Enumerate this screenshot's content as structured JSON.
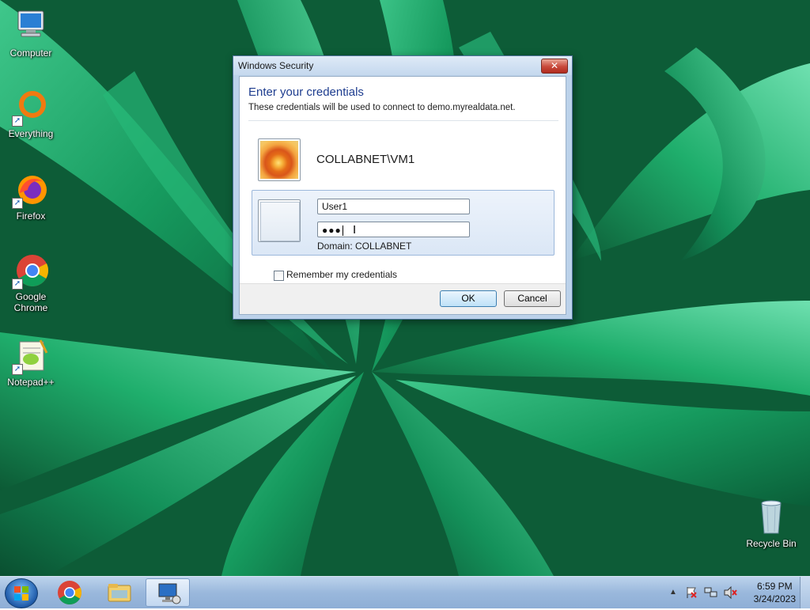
{
  "desktop": {
    "icons": [
      {
        "label": "Computer",
        "icon": "computer-icon"
      },
      {
        "label": "Everything",
        "icon": "everything-icon"
      },
      {
        "label": "Firefox",
        "icon": "firefox-icon"
      },
      {
        "label": "Google Chrome",
        "icon": "chrome-icon"
      },
      {
        "label": "Notepad++",
        "icon": "notepad-plus-plus-icon"
      },
      {
        "label": "Recycle Bin",
        "icon": "recycle-bin-icon"
      }
    ]
  },
  "dialog": {
    "window_title": "Windows Security",
    "close_glyph": "✕",
    "heading": "Enter your credentials",
    "subheading": "These credentials will be used to connect to demo.myrealdata.net.",
    "account_name": "COLLABNET\\VM1",
    "username_value": "User1",
    "password_mask": "●●●",
    "domain_label": "Domain: COLLABNET",
    "remember_label": "Remember my credentials",
    "remember_checked": false,
    "ok_label": "OK",
    "cancel_label": "Cancel"
  },
  "taskbar": {
    "pinned": [
      "chrome-icon",
      "file-explorer-icon",
      "remote-desktop-icon"
    ],
    "tray": {
      "time": "6:59 PM",
      "date": "3/24/2023",
      "icons": [
        "show-hidden-icons-chevron",
        "action-center-flag-icon",
        "network-icon",
        "volume-muted-icon"
      ]
    }
  },
  "colors": {
    "heading_blue": "#1e3d8f",
    "wallpaper_green": "#0e6a3f"
  }
}
